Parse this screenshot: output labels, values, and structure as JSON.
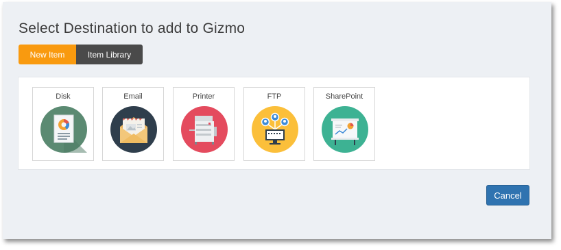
{
  "dialog": {
    "title": "Select Destination to add to Gizmo",
    "tabs": [
      {
        "label": "New Item",
        "active": true
      },
      {
        "label": "Item Library",
        "active": false
      }
    ],
    "destinations": [
      {
        "label": "Disk",
        "icon": "disk-document-icon",
        "color": "#5b8a72"
      },
      {
        "label": "Email",
        "icon": "email-envelope-icon",
        "color": "#2f3e4c"
      },
      {
        "label": "Printer",
        "icon": "printer-icon",
        "color": "#e44b5e"
      },
      {
        "label": "FTP",
        "icon": "ftp-network-icon",
        "color": "#fbbf3a"
      },
      {
        "label": "SharePoint",
        "icon": "sharepoint-presentation-icon",
        "color": "#3db293"
      }
    ],
    "cancel_label": "Cancel"
  },
  "colors": {
    "accent_tab": "#f99a0f",
    "inactive_tab": "#4a4a4a",
    "primary_button": "#2f73b0",
    "dialog_bg": "#edf0f4"
  }
}
